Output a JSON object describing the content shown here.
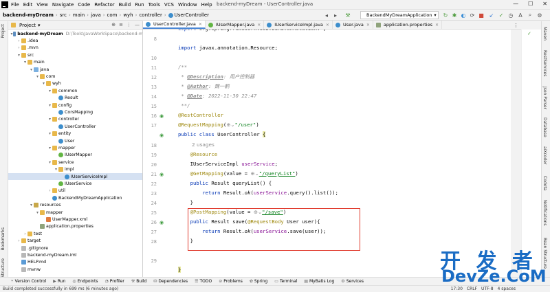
{
  "menubar": {
    "items": [
      "File",
      "Edit",
      "View",
      "Navigate",
      "Code",
      "Refactor",
      "Build",
      "Run",
      "Tools",
      "VCS",
      "Window",
      "Help"
    ],
    "title": "backend-myDream - UserController.java"
  },
  "navbar": {
    "crumbs": [
      "backend-myDream",
      "src",
      "main",
      "java",
      "com",
      "wyh",
      "controller",
      "UserController"
    ],
    "run_config": "BackendMyDreamApplication"
  },
  "project_panel": {
    "title": "Project",
    "root_path": "D:\\Tools\\JavaWorkSpace\\backend-m",
    "tree": [
      {
        "label": "backend-myDream",
        "indent": 0,
        "arrow": "▾",
        "icon": "mod",
        "bold": true
      },
      {
        "label": ".idea",
        "indent": 1,
        "arrow": "›",
        "icon": "folder"
      },
      {
        "label": ".mvn",
        "indent": 1,
        "arrow": "›",
        "icon": "folder"
      },
      {
        "label": "src",
        "indent": 1,
        "arrow": "▾",
        "icon": "folder"
      },
      {
        "label": "main",
        "indent": 2,
        "arrow": "▾",
        "icon": "folder"
      },
      {
        "label": "java",
        "indent": 3,
        "arrow": "▾",
        "icon": "src"
      },
      {
        "label": "com",
        "indent": 4,
        "arrow": "▾",
        "icon": "folder"
      },
      {
        "label": "wyh",
        "indent": 5,
        "arrow": "▾",
        "icon": "folder"
      },
      {
        "label": "common",
        "indent": 6,
        "arrow": "▾",
        "icon": "folder"
      },
      {
        "label": "Result",
        "indent": 7,
        "arrow": "",
        "icon": "cls"
      },
      {
        "label": "config",
        "indent": 6,
        "arrow": "▾",
        "icon": "folder"
      },
      {
        "label": "CorsMapping",
        "indent": 7,
        "arrow": "",
        "icon": "cls"
      },
      {
        "label": "controller",
        "indent": 6,
        "arrow": "▾",
        "icon": "folder"
      },
      {
        "label": "UserController",
        "indent": 7,
        "arrow": "",
        "icon": "cls"
      },
      {
        "label": "entity",
        "indent": 6,
        "arrow": "▾",
        "icon": "folder"
      },
      {
        "label": "User",
        "indent": 7,
        "arrow": "",
        "icon": "cls"
      },
      {
        "label": "mapper",
        "indent": 6,
        "arrow": "▾",
        "icon": "folder"
      },
      {
        "label": "IUserMapper",
        "indent": 7,
        "arrow": "",
        "icon": "itf"
      },
      {
        "label": "service",
        "indent": 6,
        "arrow": "▾",
        "icon": "folder"
      },
      {
        "label": "impl",
        "indent": 7,
        "arrow": "▾",
        "icon": "folder"
      },
      {
        "label": "IUserServiceImpl",
        "indent": 8,
        "arrow": "",
        "icon": "cls",
        "selected": true
      },
      {
        "label": "IUserService",
        "indent": 7,
        "arrow": "",
        "icon": "itf"
      },
      {
        "label": "util",
        "indent": 6,
        "arrow": "›",
        "icon": "folder"
      },
      {
        "label": "BackendMyDreamApplication",
        "indent": 6,
        "arrow": "",
        "icon": "cls"
      },
      {
        "label": "resources",
        "indent": 3,
        "arrow": "▾",
        "icon": "res"
      },
      {
        "label": "mapper",
        "indent": 4,
        "arrow": "▾",
        "icon": "folder"
      },
      {
        "label": "UserMapper.xml",
        "indent": 5,
        "arrow": "",
        "icon": "xml"
      },
      {
        "label": "application.properties",
        "indent": 4,
        "arrow": "",
        "icon": "prop"
      },
      {
        "label": "test",
        "indent": 2,
        "arrow": "›",
        "icon": "folder"
      },
      {
        "label": "target",
        "indent": 1,
        "arrow": "›",
        "icon": "folder"
      },
      {
        "label": ".gitignore",
        "indent": 1,
        "arrow": "",
        "icon": "txt"
      },
      {
        "label": "backend-myDream.iml",
        "indent": 1,
        "arrow": "",
        "icon": "txt"
      },
      {
        "label": "HELP.md",
        "indent": 1,
        "arrow": "",
        "icon": "md"
      },
      {
        "label": "mvnw",
        "indent": 1,
        "arrow": "",
        "icon": "txt"
      }
    ]
  },
  "left_strip": [
    "Project",
    "Bookmarks",
    "Structure"
  ],
  "right_strip": [
    "Maven",
    "RestServices",
    "Json Parser",
    "Database",
    "aiXcoder",
    "Codota",
    "Notifications",
    "Bean Structure"
  ],
  "tabs": [
    {
      "label": "UserController.java",
      "active": true,
      "icon": "cls"
    },
    {
      "label": "IUserMapper.java",
      "icon": "itf"
    },
    {
      "label": "IUserServiceImpl.java",
      "icon": "cls"
    },
    {
      "label": "User.java",
      "icon": "cls"
    },
    {
      "label": "application.properties",
      "icon": "prop"
    }
  ],
  "code": {
    "line_numbers": [
      "",
      "8",
      "",
      "10",
      "11",
      "12",
      "13",
      "14",
      "15",
      "16",
      "17",
      "",
      "18",
      "19",
      "20",
      "21",
      "22",
      "23",
      "24",
      "25",
      "26",
      "27",
      "28",
      "29"
    ],
    "usages_hint": "2 usages",
    "doc_description": "用户控制器",
    "doc_author": "魏一鹤",
    "doc_date": "2022-11-30 22:47",
    "mapping_user": "\"/user\"",
    "mapping_query": "\"/queryList\"",
    "mapping_save": "\"/save\""
  },
  "bottom_tools": [
    "Version Control",
    "Run",
    "Endpoints",
    "Profiler",
    "Build",
    "Dependencies",
    "TODO",
    "Problems",
    "Spring",
    "Terminal",
    "MyBatis Log",
    "Services"
  ],
  "status": {
    "message": "Build completed successfully in 699 ms (6 minutes ago)",
    "position": "17:30",
    "line_sep": "CRLF",
    "encoding": "UTF-8",
    "indent": "4 spaces"
  },
  "watermark": {
    "top": "开 发 者",
    "bottom": "DevZe.CoM"
  },
  "colors": {
    "accent": "#4a87d6",
    "highlight": "#e0392b",
    "keyword": "#0033b3",
    "annotation": "#9e880d",
    "string": "#067d17",
    "field": "#871094"
  }
}
